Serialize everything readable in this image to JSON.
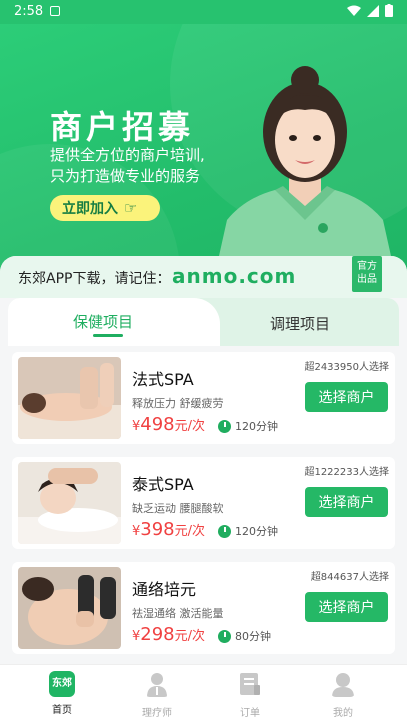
{
  "status_bar": {
    "time": "2:58"
  },
  "hero": {
    "title": "商户招募",
    "subtitle_line1": "提供全方位的商户培训,",
    "subtitle_line2": "只为打造做专业的服务",
    "join_label": "立即加入"
  },
  "notice": {
    "text": "东郊APP下载，请记住：",
    "url": "anmo.com",
    "badge_line1": "官方",
    "badge_line2": "出品"
  },
  "tabs": [
    {
      "label": "保健项目",
      "active": true
    },
    {
      "label": "调理项目",
      "active": false
    }
  ],
  "services": [
    {
      "name": "法式SPA",
      "tags": "释放压力 舒缓疲劳",
      "price": "498",
      "unit": "元/次",
      "duration": "120分钟",
      "sold": "超2433950人选择",
      "action": "选择商户"
    },
    {
      "name": "泰式SPA",
      "tags": "缺乏运动 腰腿酸软",
      "price": "398",
      "unit": "元/次",
      "duration": "120分钟",
      "sold": "超1222233人选择",
      "action": "选择商户"
    },
    {
      "name": "通络培元",
      "tags": "祛湿通络 激活能量",
      "price": "298",
      "unit": "元/次",
      "duration": "80分钟",
      "sold": "超844637人选择",
      "action": "选择商户"
    }
  ],
  "currency": "¥",
  "bottom_nav": [
    {
      "label": "首页",
      "icon_text": "东郊"
    },
    {
      "label": "理疗师"
    },
    {
      "label": "订单"
    },
    {
      "label": "我的"
    }
  ],
  "colors": {
    "brand": "#27c26f",
    "price": "#f04141",
    "button": "#25b866"
  }
}
